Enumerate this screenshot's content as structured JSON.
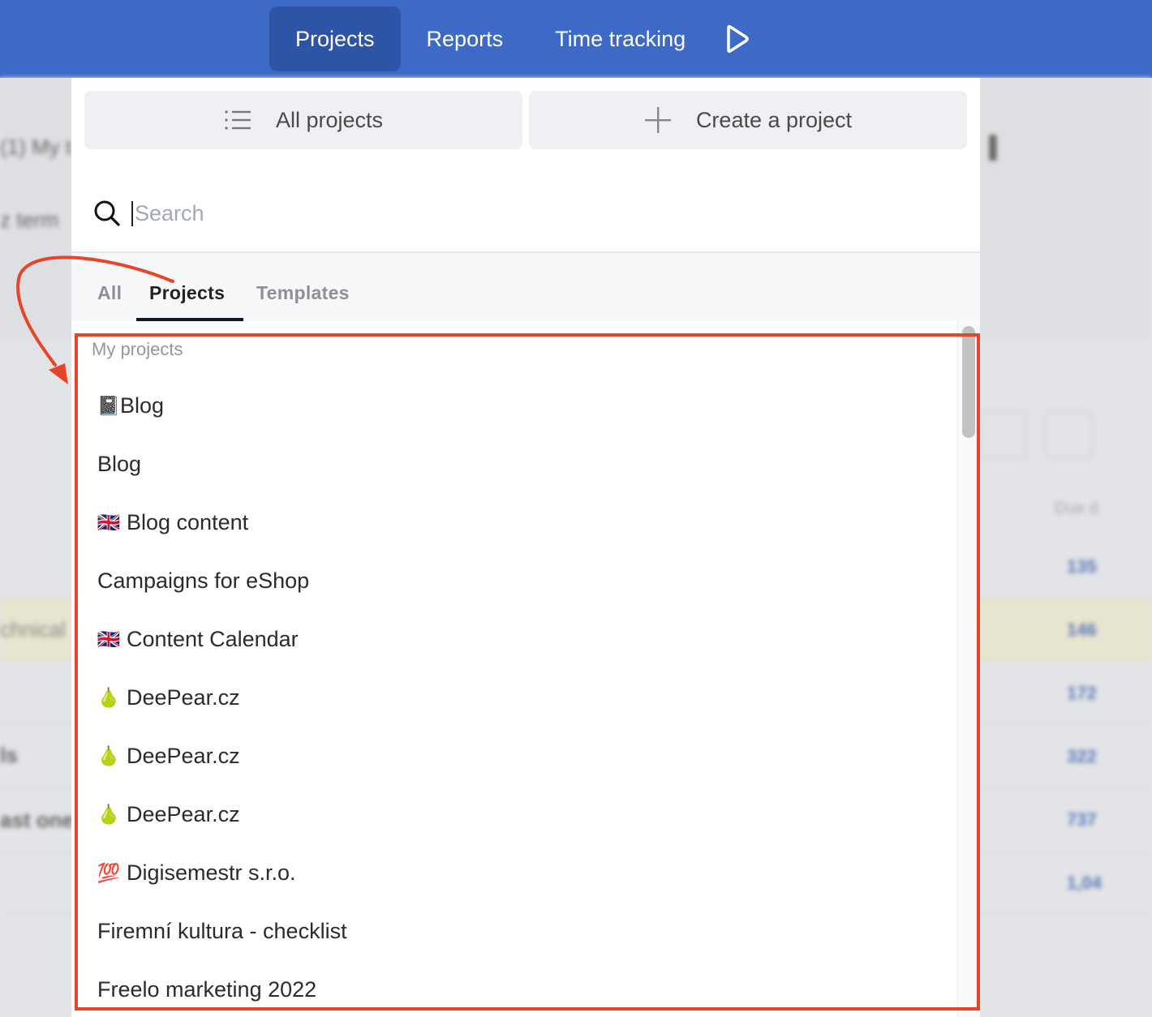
{
  "nav": {
    "items": [
      {
        "label": "Projects",
        "active": true
      },
      {
        "label": "Reports",
        "active": false
      },
      {
        "label": "Time tracking",
        "active": false
      }
    ],
    "timer_icon": "play-icon"
  },
  "background": {
    "header_texts": [
      "(1) My t",
      "z term"
    ],
    "row_texts": [
      "chnical",
      "ls",
      "ast one"
    ],
    "column_header": "Due d",
    "numbers": [
      "135",
      "146",
      "172",
      "322",
      "737",
      "1,04"
    ]
  },
  "popover": {
    "actions": {
      "all_projects": {
        "label": "All projects",
        "icon": "list-icon"
      },
      "create_project": {
        "label": "Create a project",
        "icon": "plus-icon"
      }
    },
    "search": {
      "placeholder": "Search",
      "value": "",
      "icon": "search-icon"
    },
    "tabs": [
      {
        "label": "All",
        "active": false
      },
      {
        "label": "Projects",
        "active": true
      },
      {
        "label": "Templates",
        "active": false
      }
    ],
    "section_label": "My projects",
    "projects": [
      {
        "emoji": "📓",
        "name": "Blog"
      },
      {
        "emoji": "",
        "name": "Blog"
      },
      {
        "emoji": "🇬🇧",
        "name": "Blog content"
      },
      {
        "emoji": "",
        "name": "Campaigns for eShop"
      },
      {
        "emoji": "🇬🇧",
        "name": "Content Calendar"
      },
      {
        "emoji": "🍐",
        "name": "DeePear.cz"
      },
      {
        "emoji": "🍐",
        "name": "DeePear.cz"
      },
      {
        "emoji": "🍐",
        "name": "DeePear.cz"
      },
      {
        "emoji": "💯",
        "name": "Digisemestr s.r.o."
      },
      {
        "emoji": "",
        "name": "Firemní kultura - checklist"
      },
      {
        "emoji": "",
        "name": "Freelo marketing 2022"
      }
    ]
  },
  "annotation": {
    "color": "#e8442a"
  },
  "colors": {
    "nav_bg": "#3d6ac7",
    "nav_active": "#2e54a7"
  }
}
